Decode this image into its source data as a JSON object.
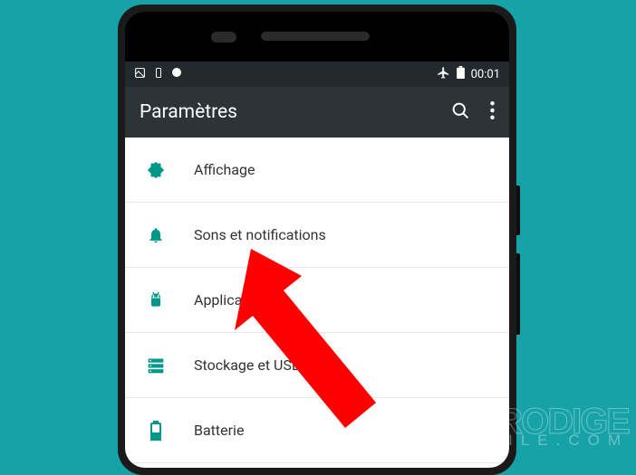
{
  "status_bar": {
    "time": "00:01"
  },
  "app_bar": {
    "title": "Paramètres"
  },
  "settings": {
    "items": [
      {
        "icon": "brightness",
        "label": "Affichage"
      },
      {
        "icon": "bell",
        "label": "Sons et notifications"
      },
      {
        "icon": "android",
        "label": "Applications"
      },
      {
        "icon": "storage",
        "label": "Stockage et USB"
      },
      {
        "icon": "battery",
        "label": "Batterie"
      }
    ]
  },
  "watermark": {
    "line1": "PRODIGE",
    "line2": "MOBILE.COM"
  },
  "colors": {
    "accent": "#009688",
    "background": "#17a2a8",
    "appbar": "#2d3438",
    "arrow": "#ff0000"
  }
}
